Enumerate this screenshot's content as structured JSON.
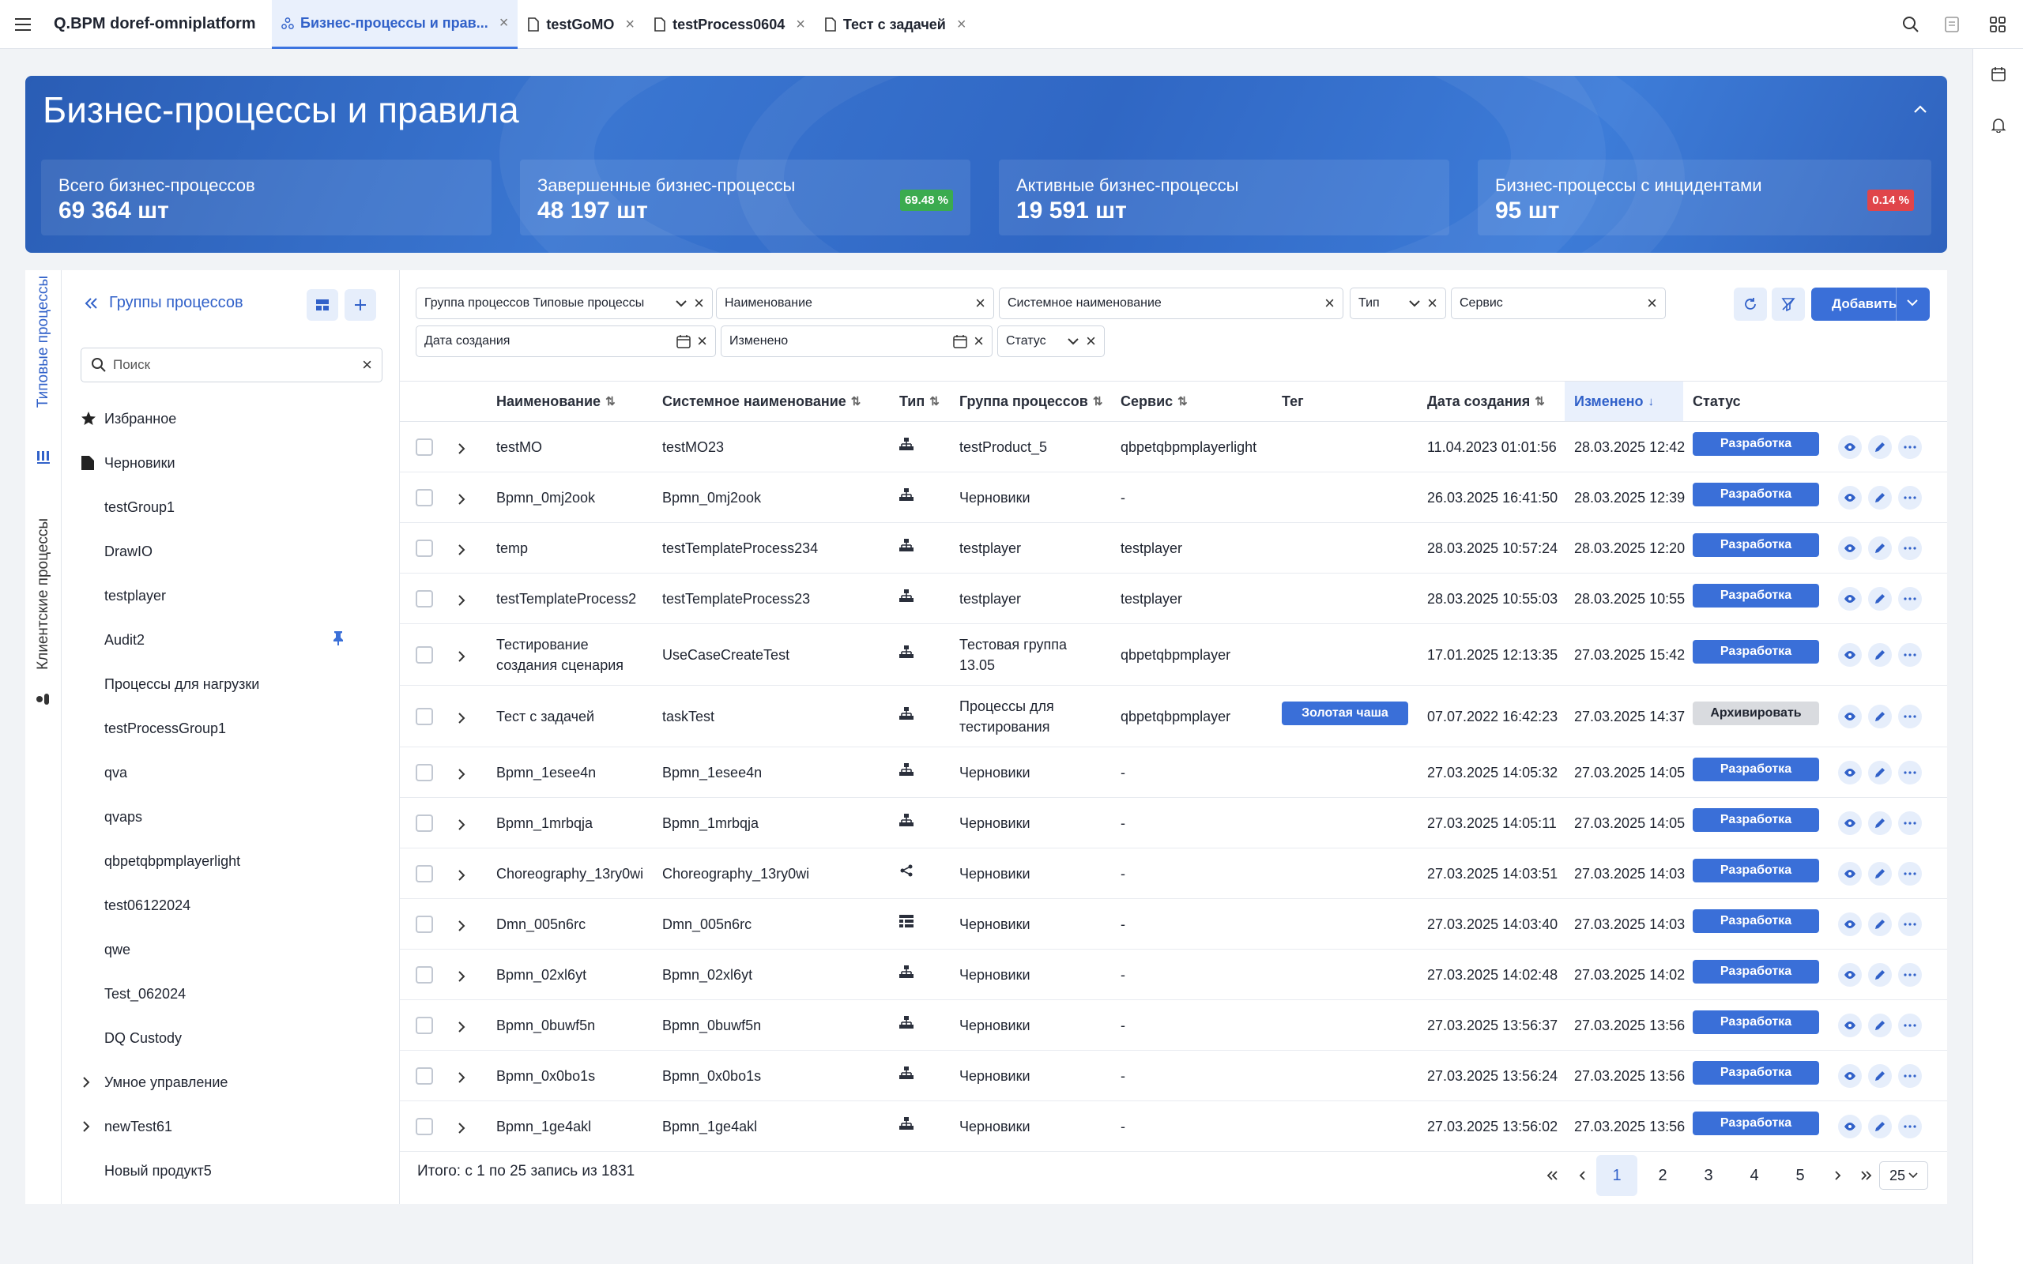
{
  "app_title": "Q.BPM doref-omniplatform",
  "tabs": [
    {
      "label": "Бизнес-процессы и прав...",
      "active": true
    },
    {
      "label": "testGoMO",
      "active": false
    },
    {
      "label": "testProcess0604",
      "active": false
    },
    {
      "label": "Тест с задачей",
      "active": false
    }
  ],
  "banner": {
    "title": "Бизнес-процессы и правила",
    "stats": [
      {
        "label": "Всего бизнес-процессов",
        "value": "69 364 шт",
        "pct": ""
      },
      {
        "label": "Завершенные бизнес-процессы",
        "value": "48 197 шт",
        "pct": "69.48 %",
        "pct_color": "#3bab4f"
      },
      {
        "label": "Активные бизнес-процессы",
        "value": "19 591 шт",
        "pct": ""
      },
      {
        "label": "Бизнес-процессы с инцидентами",
        "value": "95 шт",
        "pct": "0.14 %",
        "pct_color": "#e0454a"
      }
    ]
  },
  "vertical_tabs": {
    "typical": "Типовые процессы",
    "client": "Клиентские процессы"
  },
  "groups": {
    "title": "Группы процессов",
    "search_placeholder": "Поиск",
    "items": [
      {
        "label": "Избранное",
        "icon": "star-icon"
      },
      {
        "label": "Черновики",
        "icon": "document-icon"
      },
      {
        "label": "testGroup1"
      },
      {
        "label": "DrawIO"
      },
      {
        "label": "testplayer"
      },
      {
        "label": "Audit2",
        "pinned": true
      },
      {
        "label": "Процессы для нагрузки"
      },
      {
        "label": "testProcessGroup1"
      },
      {
        "label": "qva"
      },
      {
        "label": "qvaps"
      },
      {
        "label": "qbpetqbpmplayerlight"
      },
      {
        "label": "test06122024"
      },
      {
        "label": "qwe"
      },
      {
        "label": "Test_062024"
      },
      {
        "label": "DQ Custody"
      },
      {
        "label": "Умное управление",
        "expandable": true
      },
      {
        "label": "newTest61",
        "expandable": true
      },
      {
        "label": "Новый продукт5"
      }
    ]
  },
  "filters": {
    "group": "Группа процессов Типовые процессы",
    "name": "Наименование",
    "system_name": "Системное наименование",
    "type": "Тип",
    "service": "Сервис",
    "created": "Дата создания",
    "modified": "Изменено",
    "status": "Статус"
  },
  "add_button": "Добавить",
  "columns": {
    "name": "Наименование",
    "system_name": "Системное наименование",
    "type": "Тип",
    "group": "Группа процессов",
    "service": "Сервис",
    "tag": "Тег",
    "created": "Дата создания",
    "modified": "Изменено",
    "status": "Статус"
  },
  "colors": {
    "accent": "#3a6fd8",
    "dev": "#3a6fd8",
    "archive": "#d9dbdf"
  },
  "rows": [
    {
      "name": "testMO",
      "system": "testMO23",
      "type": "bpmn",
      "group": "testProduct_5",
      "service": "qbpetqbpmplayerlight",
      "tag": "",
      "created": "11.04.2023 01:01:56",
      "modified": "28.03.2025 12:42",
      "status": "Разработка"
    },
    {
      "name": "Bpmn_0mj2ook",
      "system": "Bpmn_0mj2ook",
      "type": "bpmn",
      "group": "Черновики",
      "service": "-",
      "tag": "",
      "created": "26.03.2025 16:41:50",
      "modified": "28.03.2025 12:39",
      "status": "Разработка"
    },
    {
      "name": "temp",
      "system": "testTemplateProcess234",
      "type": "bpmn",
      "group": "testplayer",
      "service": "testplayer",
      "tag": "",
      "created": "28.03.2025 10:57:24",
      "modified": "28.03.2025 12:20",
      "status": "Разработка"
    },
    {
      "name": "testTemplateProcess2",
      "system": "testTemplateProcess23",
      "type": "bpmn",
      "group": "testplayer",
      "service": "testplayer",
      "tag": "",
      "created": "28.03.2025 10:55:03",
      "modified": "28.03.2025 10:55",
      "status": "Разработка"
    },
    {
      "name": "Тестирование",
      "name2": "создания сценария",
      "system": "UseCaseCreateTest",
      "type": "bpmn",
      "group": "Тестовая группа",
      "group2": "13.05",
      "service": "qbpetqbpmplayer",
      "tag": "",
      "created": "17.01.2025 12:13:35",
      "modified": "27.03.2025 15:42",
      "status": "Разработка"
    },
    {
      "name": "Тест с задачей",
      "system": "taskTest",
      "type": "bpmn",
      "group": "Процессы для",
      "group2": "тестирования",
      "service": "qbpetqbpmplayer",
      "tag": "Золотая чаша",
      "created": "07.07.2022 16:42:23",
      "modified": "27.03.2025 14:37",
      "status": "Архивировать",
      "archive": true
    },
    {
      "name": "Bpmn_1esee4n",
      "system": "Bpmn_1esee4n",
      "type": "bpmn",
      "group": "Черновики",
      "service": "-",
      "tag": "",
      "created": "27.03.2025 14:05:32",
      "modified": "27.03.2025 14:05",
      "status": "Разработка"
    },
    {
      "name": "Bpmn_1mrbqja",
      "system": "Bpmn_1mrbqja",
      "type": "bpmn",
      "group": "Черновики",
      "service": "-",
      "tag": "",
      "created": "27.03.2025 14:05:11",
      "modified": "27.03.2025 14:05",
      "status": "Разработка"
    },
    {
      "name": "Choreography_13ry0wi",
      "system": "Choreography_13ry0wi",
      "type": "choreography",
      "group": "Черновики",
      "service": "-",
      "tag": "",
      "created": "27.03.2025 14:03:51",
      "modified": "27.03.2025 14:03",
      "status": "Разработка"
    },
    {
      "name": "Dmn_005n6rc",
      "system": "Dmn_005n6rc",
      "type": "dmn",
      "group": "Черновики",
      "service": "-",
      "tag": "",
      "created": "27.03.2025 14:03:40",
      "modified": "27.03.2025 14:03",
      "status": "Разработка"
    },
    {
      "name": "Bpmn_02xl6yt",
      "system": "Bpmn_02xl6yt",
      "type": "bpmn",
      "group": "Черновики",
      "service": "-",
      "tag": "",
      "created": "27.03.2025 14:02:48",
      "modified": "27.03.2025 14:02",
      "status": "Разработка"
    },
    {
      "name": "Bpmn_0buwf5n",
      "system": "Bpmn_0buwf5n",
      "type": "bpmn",
      "group": "Черновики",
      "service": "-",
      "tag": "",
      "created": "27.03.2025 13:56:37",
      "modified": "27.03.2025 13:56",
      "status": "Разработка"
    },
    {
      "name": "Bpmn_0x0bo1s",
      "system": "Bpmn_0x0bo1s",
      "type": "bpmn",
      "group": "Черновики",
      "service": "-",
      "tag": "",
      "created": "27.03.2025 13:56:24",
      "modified": "27.03.2025 13:56",
      "status": "Разработка"
    },
    {
      "name": "Bpmn_1ge4akl",
      "system": "Bpmn_1ge4akl",
      "type": "bpmn",
      "group": "Черновики",
      "service": "-",
      "tag": "",
      "created": "27.03.2025 13:56:02",
      "modified": "27.03.2025 13:56",
      "status": "Разработка"
    }
  ],
  "pagination": {
    "total": "Итого: с 1 по 25 запись из 1831",
    "pages": [
      "1",
      "2",
      "3",
      "4",
      "5"
    ],
    "current": "1",
    "page_size": "25"
  }
}
